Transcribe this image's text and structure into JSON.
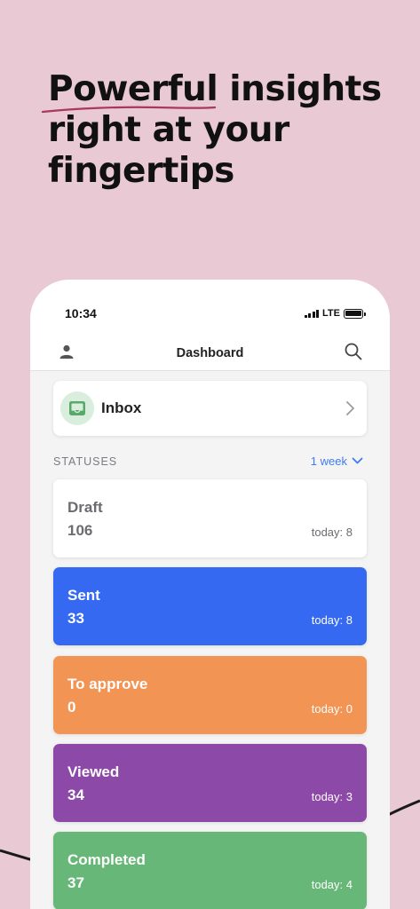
{
  "headline": {
    "line1_word1": "Powerful",
    "line1_word2": "insights",
    "line2": "right at your",
    "line3": "fingertips"
  },
  "status_bar": {
    "time": "10:34",
    "network": "LTE"
  },
  "nav": {
    "title": "Dashboard"
  },
  "inbox": {
    "label": "Inbox"
  },
  "statuses": {
    "section_label": "STATUSES",
    "period": "1 week",
    "items": [
      {
        "name": "Draft",
        "count": "106",
        "today": "today: 8",
        "color": "#FFFFFF"
      },
      {
        "name": "Sent",
        "count": "33",
        "today": "today: 8",
        "color": "#3569F2"
      },
      {
        "name": "To approve",
        "count": "0",
        "today": "today: 0",
        "color": "#F19454"
      },
      {
        "name": "Viewed",
        "count": "34",
        "today": "today: 3",
        "color": "#8D49A8"
      },
      {
        "name": "Completed",
        "count": "37",
        "today": "today: 4",
        "color": "#67B878"
      }
    ]
  },
  "colors": {
    "background": "#E8C9D4",
    "accent_underline": "#A8385E",
    "link_blue": "#3D7BF0"
  }
}
